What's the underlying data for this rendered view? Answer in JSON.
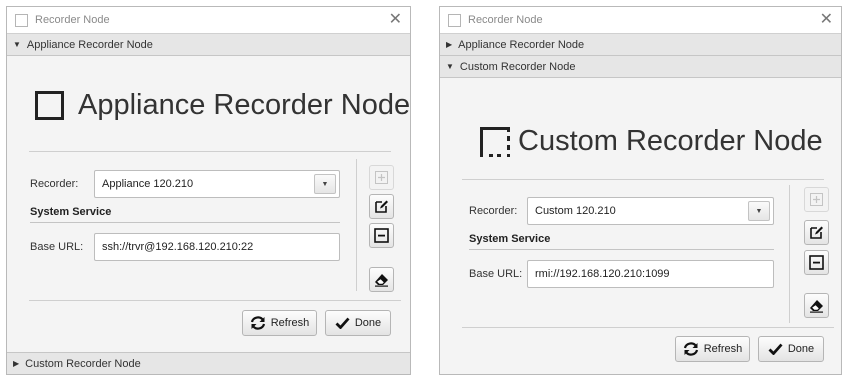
{
  "left": {
    "window_title": "Recorder Node",
    "accordion_top": "Appliance Recorder Node",
    "accordion_bottom": "Custom Recorder Node",
    "heading": "Appliance Recorder Node",
    "recorder_label": "Recorder:",
    "recorder_value": "Appliance 120.210",
    "section_title": "System Service",
    "base_url_label": "Base URL:",
    "base_url_value": "ssh://trvr@192.168.120.210:22",
    "refresh_label": "Refresh",
    "done_label": "Done"
  },
  "right": {
    "window_title": "Recorder Node",
    "accordion_top": "Appliance Recorder Node",
    "accordion_expanded": "Custom Recorder Node",
    "heading": "Custom Recorder Node",
    "recorder_label": "Recorder:",
    "recorder_value": "Custom 120.210",
    "section_title": "System Service",
    "base_url_label": "Base URL:",
    "base_url_value": "rmi://192.168.120.210:1099",
    "refresh_label": "Refresh",
    "done_label": "Done"
  },
  "glyphs": {
    "close": "✕",
    "collapsed_arrow": "▶",
    "expanded_arrow": "▼",
    "combo_arrow": "▼"
  },
  "icons": [
    "checkbox-icon",
    "close-icon",
    "square-icon",
    "dashed-square-icon",
    "add-icon",
    "edit-icon",
    "remove-icon",
    "eraser-icon",
    "refresh-icon",
    "checkmark-icon"
  ]
}
